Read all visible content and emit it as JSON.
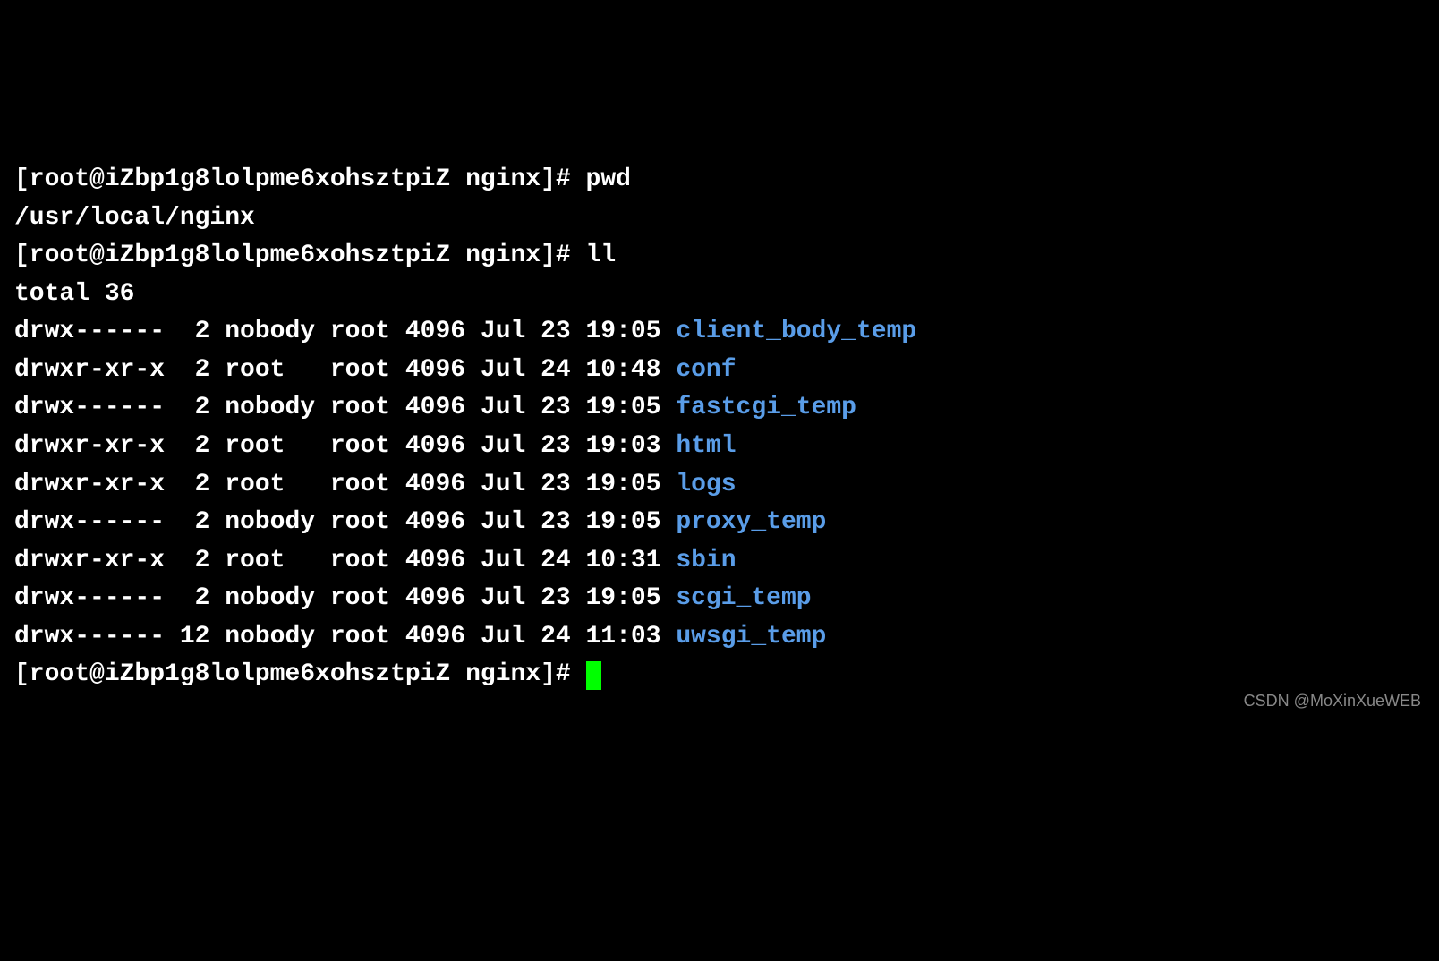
{
  "prompt": "[root@iZbp1g8lolpme6xohsztpiZ nginx]# ",
  "cmd_pwd": "pwd",
  "pwd_output": "/usr/local/nginx",
  "cmd_ll": "ll",
  "total_line": "total 36",
  "entries": [
    {
      "meta": "drwx------  2 nobody root 4096 Jul 23 19:05 ",
      "name": "client_body_temp"
    },
    {
      "meta": "drwxr-xr-x  2 root   root 4096 Jul 24 10:48 ",
      "name": "conf"
    },
    {
      "meta": "drwx------  2 nobody root 4096 Jul 23 19:05 ",
      "name": "fastcgi_temp"
    },
    {
      "meta": "drwxr-xr-x  2 root   root 4096 Jul 23 19:03 ",
      "name": "html"
    },
    {
      "meta": "drwxr-xr-x  2 root   root 4096 Jul 23 19:05 ",
      "name": "logs"
    },
    {
      "meta": "drwx------  2 nobody root 4096 Jul 23 19:05 ",
      "name": "proxy_temp"
    },
    {
      "meta": "drwxr-xr-x  2 root   root 4096 Jul 24 10:31 ",
      "name": "sbin"
    },
    {
      "meta": "drwx------  2 nobody root 4096 Jul 23 19:05 ",
      "name": "scgi_temp"
    },
    {
      "meta": "drwx------ 12 nobody root 4096 Jul 24 11:03 ",
      "name": "uwsgi_temp"
    }
  ],
  "watermark": "CSDN @MoXinXueWEB"
}
